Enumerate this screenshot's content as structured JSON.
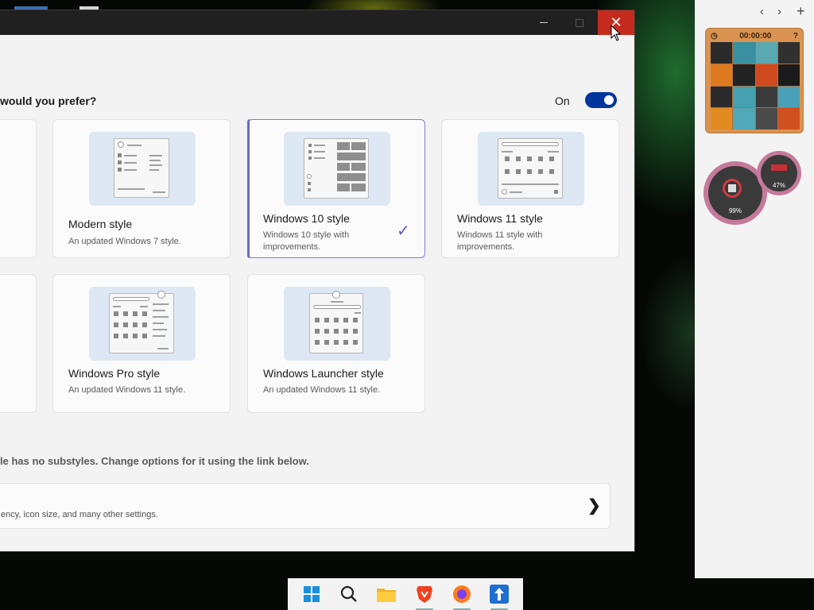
{
  "window": {
    "title": "",
    "minimize_glyph": "—",
    "close_glyph": "✕"
  },
  "main": {
    "question": "would you prefer?",
    "toggle_label": "On",
    "toggle_state": "on",
    "cards": [
      {
        "title": "Modern style",
        "description": "An updated Windows 7 style.",
        "selected": false
      },
      {
        "title": "Windows 10 style",
        "description": "Windows 10 style with improvements.",
        "selected": true
      },
      {
        "title": "Windows 11 style",
        "description": "Windows 11 style with improvements.",
        "selected": false
      },
      {
        "title": "Windows Pro style",
        "description": "An updated Windows 11 style.",
        "selected": false
      },
      {
        "title": "Windows Launcher style",
        "description": "An updated Windows 11 style.",
        "selected": false
      }
    ],
    "check_glyph": "✓",
    "note": "le has no substyles.  Change options for it using the link below.",
    "settings_row_text": "ency, icon size, and many other settings.",
    "settings_row_chevron": "❯"
  },
  "sidebar": {
    "back": "‹",
    "forward": "›",
    "add": "+",
    "puzzle_timer": "00:00:00",
    "meter_large_pct": "99%",
    "meter_small_pct": "47%"
  },
  "taskbar": {
    "icons": [
      "windows-start-icon",
      "search-icon",
      "file-explorer-icon",
      "brave-browser-icon",
      "firefox-icon",
      "app-update-icon"
    ]
  },
  "colors": {
    "accent": "#00369b",
    "selection": "#6a6acc",
    "close": "#c42b1c"
  }
}
